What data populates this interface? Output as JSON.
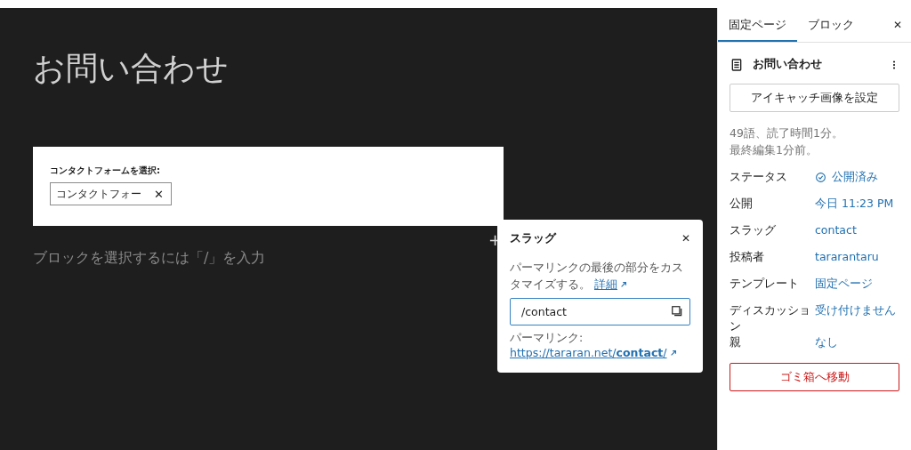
{
  "editor": {
    "title": "お問い合わせ",
    "form_block": {
      "label": "コンタクトフォームを選択:",
      "token": "コンタクトフォー",
      "remove": "✕"
    },
    "placeholder": "ブロックを選択するには「/」を入力",
    "inserter": "+"
  },
  "slug_popover": {
    "title": "スラッグ",
    "close": "✕",
    "description": "パーマリンクの最後の部分をカスタマイズする。",
    "more_link": "詳細",
    "slug_value": "/contact",
    "permalink_label": "パーマリンク:",
    "permalink_url": "https://tararan.net/**contact**/"
  },
  "sidebar": {
    "tabs": [
      {
        "label": "固定ページ",
        "selected": true
      },
      {
        "label": "ブロック",
        "selected": false
      }
    ],
    "close": "✕",
    "page_title": "お問い合わせ",
    "featured_image_button": "アイキャッチ画像を設定",
    "stats": [
      "49語、読了時間1分。",
      "最終編集1分前。"
    ],
    "fields": [
      {
        "label": "ステータス",
        "value": "公開済み",
        "kind": "status"
      },
      {
        "label": "公開",
        "value": "今日 11:23 PM",
        "kind": "link"
      },
      {
        "label": "スラッグ",
        "value": "contact",
        "kind": "link"
      },
      {
        "label": "投稿者",
        "value": "tararantaru",
        "kind": "link"
      },
      {
        "label": "テンプレート",
        "value": "固定ページ",
        "kind": "link"
      },
      {
        "label": "ディスカッション",
        "value": "受け付けません",
        "kind": "link"
      },
      {
        "label": "親",
        "value": "なし",
        "kind": "link"
      }
    ],
    "trash_button": "ゴミ箱へ移動"
  }
}
